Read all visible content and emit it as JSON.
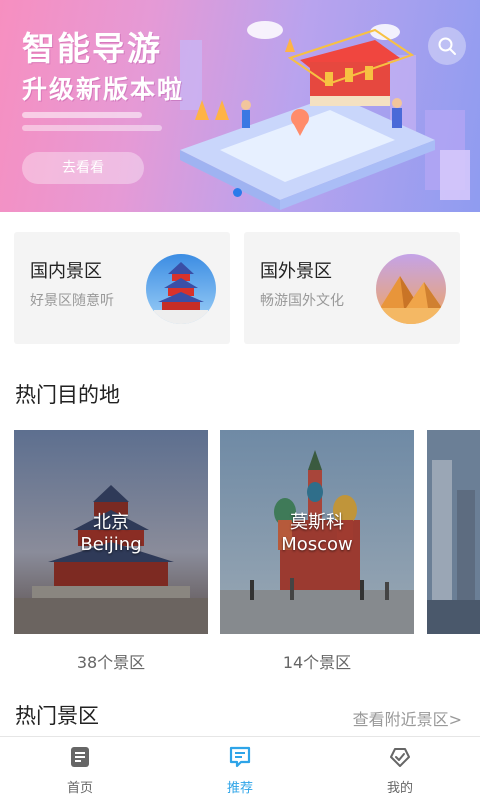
{
  "banner": {
    "title_line1": "智能导游",
    "title_line2": "升级新版本啦",
    "button_label": "去看看",
    "search_icon": "search-icon",
    "active_dot_color": "#2b7bea"
  },
  "categories": [
    {
      "name": "国内景区",
      "subtitle": "好景区随意听",
      "icon": "temple-of-heaven-thumb"
    },
    {
      "name": "国外景区",
      "subtitle": "畅游国外文化",
      "icon": "pyramids-thumb"
    }
  ],
  "hot_destinations": {
    "title": "热门目的地",
    "items": [
      {
        "name_cn": "北京",
        "name_en": "Beijing",
        "count": "38个景区"
      },
      {
        "name_cn": "莫斯科",
        "name_en": "Moscow",
        "count": "14个景区"
      }
    ]
  },
  "hot_spots": {
    "title": "热门景区",
    "more_link": "查看附近景区>"
  },
  "tabbar": {
    "active_color": "#2ea4e8",
    "items": [
      {
        "label": "首页",
        "icon": "home-doc-icon",
        "active": false
      },
      {
        "label": "推荐",
        "icon": "recommend-chat-icon",
        "active": true
      },
      {
        "label": "我的",
        "icon": "profile-heart-icon",
        "active": false
      }
    ]
  }
}
